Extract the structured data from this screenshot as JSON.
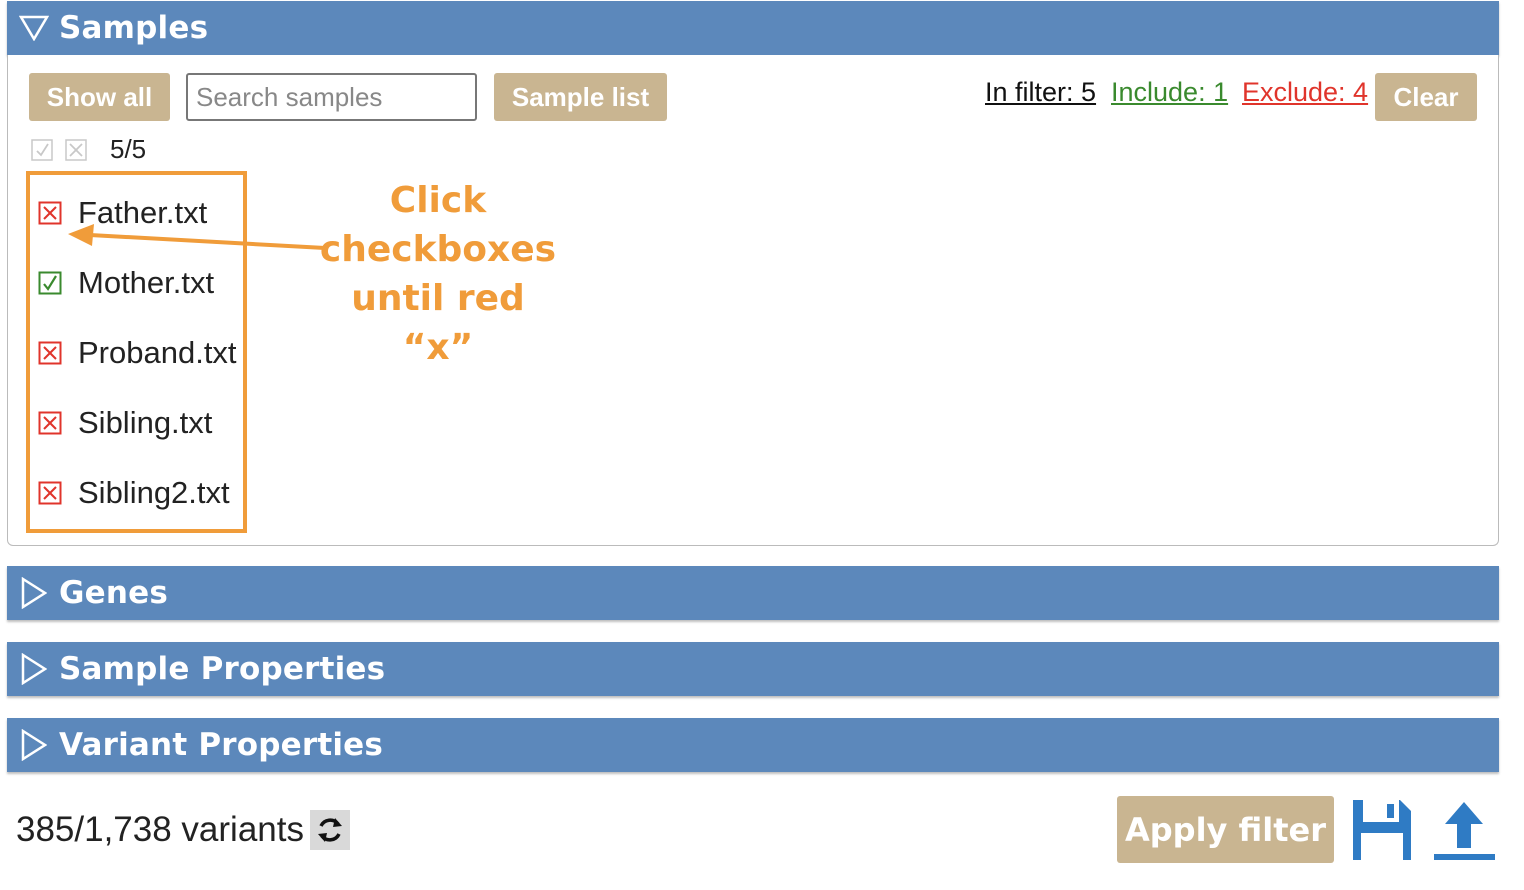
{
  "panels": {
    "samples": {
      "title": "Samples",
      "expanded": true
    },
    "genes": {
      "title": "Genes",
      "expanded": false
    },
    "sample_properties": {
      "title": "Sample Properties",
      "expanded": false
    },
    "variant_properties": {
      "title": "Variant Properties",
      "expanded": false
    }
  },
  "samples_toolbar": {
    "show_all_label": "Show all",
    "search_placeholder": "Search samples",
    "search_value": "",
    "sample_list_label": "Sample list",
    "in_filter_label": "In filter: 5",
    "include_label": "Include: 1",
    "exclude_label": "Exclude: 4",
    "clear_label": "Clear"
  },
  "selection_count": "5/5",
  "samples": [
    {
      "name": "Father.txt",
      "state": "exclude"
    },
    {
      "name": "Mother.txt",
      "state": "include"
    },
    {
      "name": "Proband.txt",
      "state": "exclude"
    },
    {
      "name": "Sibling.txt",
      "state": "exclude"
    },
    {
      "name": "Sibling2.txt",
      "state": "exclude"
    }
  ],
  "annotation": {
    "line1": "Click",
    "line2": "checkboxes",
    "line3": "until red “x”"
  },
  "footer": {
    "variants_text": "385/1,738 variants",
    "apply_label": "Apply filter"
  },
  "icons": {
    "refresh": "refresh-icon",
    "save": "floppy-disk-icon",
    "upload": "upload-arrow-icon",
    "expanded": "triangle-down-icon",
    "collapsed": "triangle-right-icon"
  },
  "colors": {
    "header_bg": "#5c88bb",
    "button_bg": "#c9b591",
    "include_green": "#3a8a2e",
    "exclude_red": "#e0342b",
    "annotation_orange": "#f09c3a",
    "icon_blue": "#2f7bc4"
  }
}
